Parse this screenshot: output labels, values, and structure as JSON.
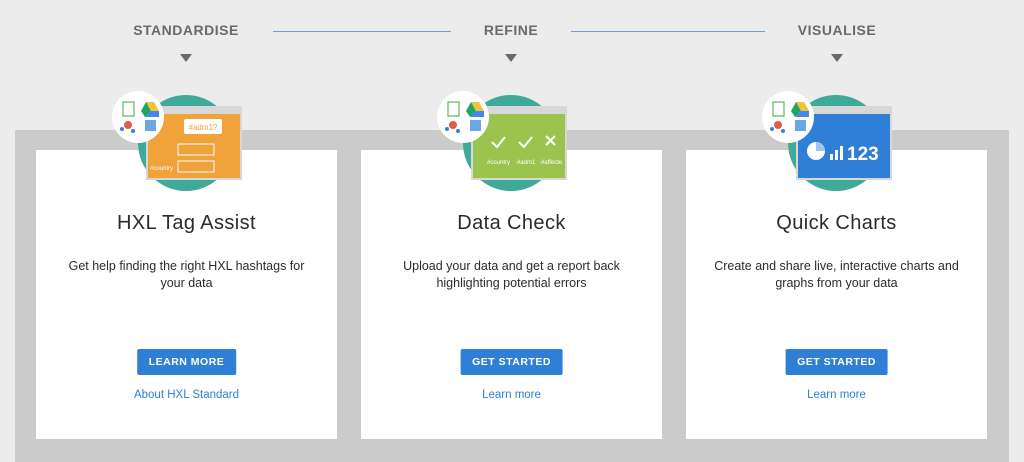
{
  "steps": [
    "STANDARDISE",
    "REFINE",
    "VISUALISE"
  ],
  "cards": [
    {
      "title": "HXL Tag Assist",
      "description": "Get help finding the right HXL hashtags for your data",
      "cta": "LEARN MORE",
      "link": "About HXL Standard",
      "illustration": {
        "accent": "#f0a23b",
        "bubble_text": "#adm1?",
        "labels": [
          "#country"
        ]
      }
    },
    {
      "title": "Data Check",
      "description": "Upload your data and get a report back highlighting potential errors",
      "cta": "GET STARTED",
      "link": "Learn more",
      "illustration": {
        "accent": "#9bc44f",
        "labels": [
          "#country",
          "#adm1",
          "#affecte"
        ]
      }
    },
    {
      "title": "Quick Charts",
      "description": "Create and share live, interactive charts and graphs from your data",
      "cta": "GET STARTED",
      "link": "Learn more",
      "illustration": {
        "accent": "#2f7fd6",
        "number_text": "123"
      }
    }
  ],
  "colors": {
    "primary": "#2f7fd6",
    "teal": "#3fa99a",
    "band": "#cbcbcb",
    "background": "#ececec"
  }
}
